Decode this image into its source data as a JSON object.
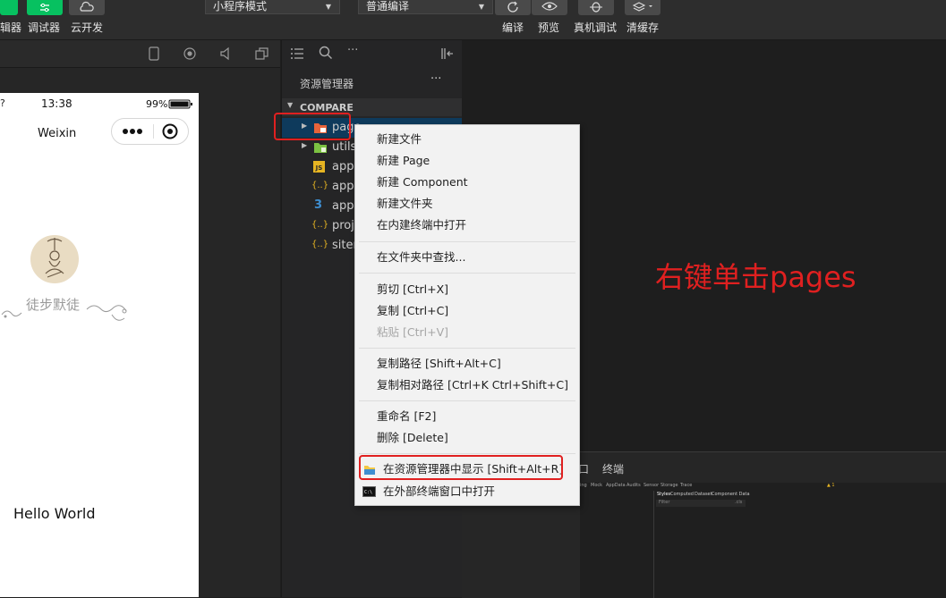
{
  "toolbar": {
    "left_labels": [
      "辑器",
      "调试器",
      "云开发"
    ],
    "mode_select": "小程序模式",
    "compile_select": "普通编译",
    "right_labels": [
      "编译",
      "预览",
      "真机调试",
      "清缓存"
    ]
  },
  "phone": {
    "time": "13:38",
    "battery": "99%",
    "nav_title": "Weixin",
    "nickname": "徒步默徒",
    "hello": "Hello World"
  },
  "explorer": {
    "title": "资源管理器",
    "more": "···",
    "section": "COMPARE",
    "items": [
      {
        "label": "page",
        "kind": "folder-pages"
      },
      {
        "label": "utils",
        "kind": "folder-utils"
      },
      {
        "label": "app.",
        "kind": "js"
      },
      {
        "label": "app.",
        "kind": "json"
      },
      {
        "label": "app.",
        "kind": "css"
      },
      {
        "label": "proje",
        "kind": "json"
      },
      {
        "label": "siter",
        "kind": "json"
      }
    ],
    "icon_glyphs": {
      "js": "JS",
      "json": "{..}",
      "css": "3"
    }
  },
  "menu": {
    "groups": [
      [
        "新建文件",
        "新建 Page",
        "新建 Component",
        "新建文件夹",
        "在内建终端中打开"
      ],
      [
        "在文件夹中查找..."
      ],
      [
        "剪切 [Ctrl+X]",
        "复制 [Ctrl+C]",
        "粘贴 [Ctrl+V]"
      ],
      [
        "复制路径 [Shift+Alt+C]",
        "复制相对路径 [Ctrl+K Ctrl+Shift+C]"
      ],
      [
        "重命名 [F2]",
        "删除 [Delete]"
      ],
      [
        "在资源管理器中显示 [Shift+Alt+R]",
        "在外部终端窗口中打开"
      ]
    ],
    "disabled_item": "粘贴 [Ctrl+V]"
  },
  "annotation": "右键单击pages",
  "bottom_panel": {
    "tab": "终端",
    "tab_prefix": "口",
    "devtools_tabs": [
      "ing",
      "Mock",
      "AppData",
      "Audits",
      "Sensor",
      "Storage",
      "Trace"
    ],
    "sub_tabs": [
      "Styles",
      "Computed",
      "Dataset",
      "Component Data"
    ],
    "filter": "Filter",
    "filter_hint": ".cls",
    "warning": "▲ 1"
  },
  "colors": {
    "accent_green": "#07c160",
    "annotation_red": "#e02020",
    "folder_pages": "#e8633a",
    "folder_utils": "#7cc242",
    "js_yellow": "#e6b422",
    "css_blue": "#3e8ed0"
  }
}
